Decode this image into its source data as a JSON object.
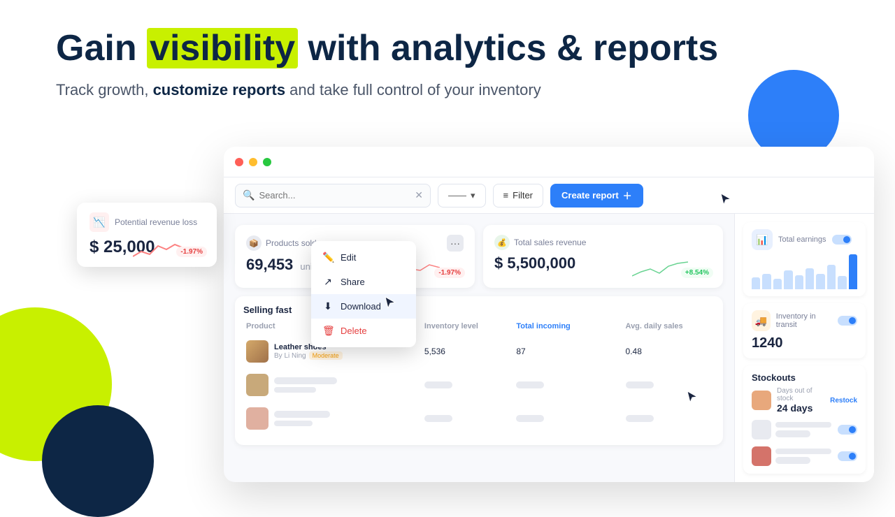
{
  "hero": {
    "title_part1": "Gain ",
    "title_highlight": "visibility",
    "title_part2": " with analytics & reports",
    "subtitle_part1": "Track growth, ",
    "subtitle_bold": "customize reports",
    "subtitle_part2": " and take full control of your inventory"
  },
  "toolbar": {
    "search_placeholder": "Search...",
    "search_value": "",
    "dropdown_label": "——",
    "filter_label": "Filter",
    "create_report_label": "Create report"
  },
  "metrics": {
    "products_sold": {
      "title": "Products sold",
      "value": "69,453",
      "unit": "units",
      "change": "-1.97%"
    },
    "total_sales": {
      "title": "Total sales revenue",
      "value": "$ 5,500,000",
      "change": "+8.54%"
    }
  },
  "right_panel": {
    "total_earnings": {
      "title": "Total earnings",
      "bars": [
        35,
        45,
        30,
        50,
        40,
        55,
        42,
        60,
        38,
        70
      ]
    },
    "inventory_transit": {
      "title": "Inventory in transit",
      "value": "1240"
    },
    "stockouts": {
      "title": "Stockouts",
      "days_label": "Days out of stock",
      "days_value": "24 days",
      "restock_label": "Restock"
    }
  },
  "table": {
    "title": "Selling fast",
    "columns": [
      "Product",
      "Inventory level",
      "Total incoming",
      "Avg. daily sales"
    ],
    "rows": [
      {
        "name": "Leather shoes",
        "brand": "By Li Ning",
        "badge": "Moderate",
        "inventory": "5,536",
        "incoming": "87",
        "daily_sales": "0.48"
      }
    ]
  },
  "floating_card": {
    "title": "Potential revenue loss",
    "value": "$ 25,000",
    "change": "-1.97%"
  },
  "context_menu": {
    "items": [
      "Edit",
      "Share",
      "Download",
      "Delete"
    ]
  }
}
